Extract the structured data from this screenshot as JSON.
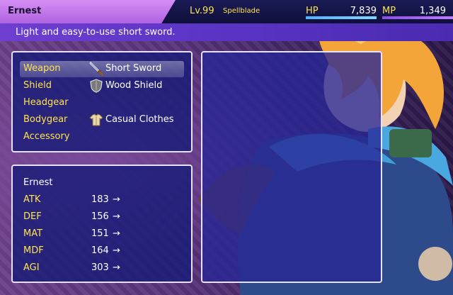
{
  "header": {
    "name": "Ernest",
    "level": "Lv.99",
    "class": "Spellblade",
    "hp_label": "HP",
    "hp_value": "7,839",
    "mp_label": "MP",
    "mp_value": "1,349",
    "hp_fill": 1.0,
    "mp_fill": 1.0,
    "colors": {
      "name_tab": "#c57be9",
      "label": "#ffe34d",
      "hp_gauge": "#7fd7ff",
      "mp_gauge": "#c07bff"
    }
  },
  "help": {
    "text": "Light and easy-to-use short sword."
  },
  "equip": {
    "slots": [
      {
        "slot": "Weapon",
        "item": "Short Sword",
        "icon": "sword-icon"
      },
      {
        "slot": "Shield",
        "item": "Wood Shield",
        "icon": "shield-icon"
      },
      {
        "slot": "Headgear",
        "item": "",
        "icon": ""
      },
      {
        "slot": "Bodygear",
        "item": "Casual Clothes",
        "icon": "clothes-icon"
      },
      {
        "slot": "Accessory",
        "item": "",
        "icon": ""
      }
    ]
  },
  "status": {
    "name": "Ernest",
    "arrow": "→",
    "params": [
      {
        "label": "ATK",
        "value": "183"
      },
      {
        "label": "DEF",
        "value": "156"
      },
      {
        "label": "MAT",
        "value": "151"
      },
      {
        "label": "MDF",
        "value": "164"
      },
      {
        "label": "AGI",
        "value": "303"
      }
    ]
  }
}
